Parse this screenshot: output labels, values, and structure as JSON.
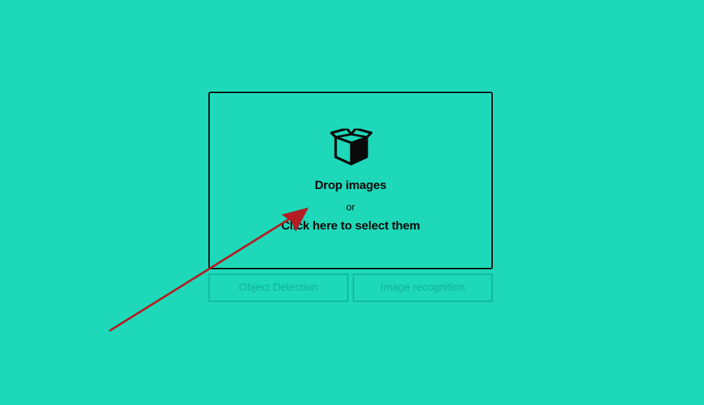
{
  "dropzone": {
    "icon": "open-box-icon",
    "title": "Drop images",
    "or": "or",
    "select": "Click here to select them"
  },
  "modes": {
    "object_detection": "Object Detection",
    "image_recognition": "Image recognition"
  },
  "colors": {
    "background": "#1dd8b9",
    "border": "#0a0a0a",
    "button_border": "#13b89c",
    "button_text": "#12b396",
    "arrow": "#b51c23"
  }
}
